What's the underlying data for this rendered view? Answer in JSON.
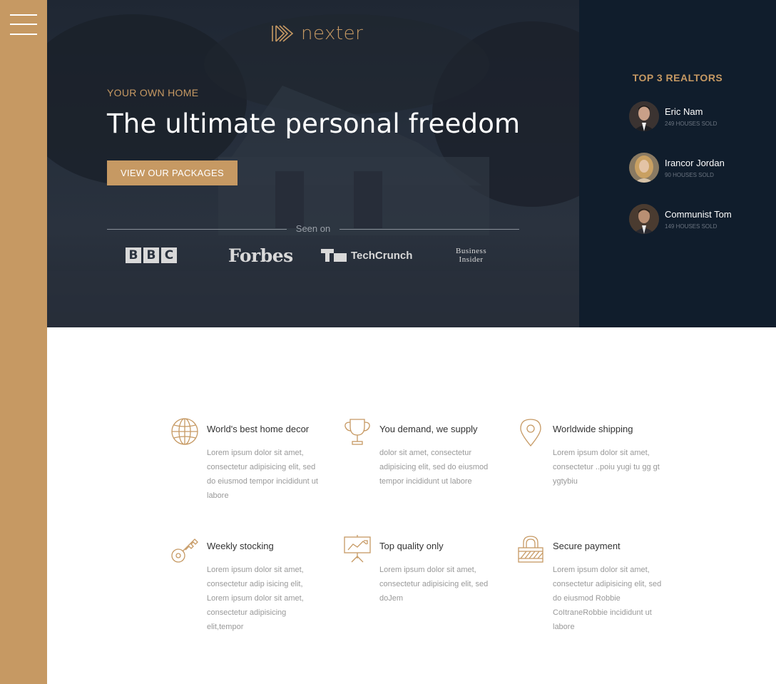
{
  "brand": {
    "logo_text": "nexter",
    "accent": "#c69963",
    "dark": "#101d2c"
  },
  "nav": {
    "menu_icon": "hamburger-icon"
  },
  "hero": {
    "subtitle": "YOUR OWN HOME",
    "title": "The ultimate personal freedom",
    "button": "VIEW OUR PACKAGES",
    "seen_on": "Seen on",
    "press": {
      "bbc": [
        "B",
        "B",
        "C"
      ],
      "forbes": "Forbes",
      "techcrunch": "TechCrunch",
      "business_insider_line1": "Business",
      "business_insider_line2": "Insider"
    }
  },
  "realtors": {
    "title": "TOP 3 REALTORS",
    "items": [
      {
        "name": "Eric Nam",
        "sold": "249 HOUSES SOLD"
      },
      {
        "name": "Irancor Jordan",
        "sold": "90 HOUSES SOLD"
      },
      {
        "name": "Communist Tom",
        "sold": "149 HOUSES SOLD"
      }
    ]
  },
  "features": [
    {
      "icon": "globe-icon",
      "title": "World's best home decor",
      "text": "Lorem ipsum dolor sit amet, consectetur adipisicing elit, sed do eiusmod tempor incididunt ut labore"
    },
    {
      "icon": "trophy-icon",
      "title": "You demand, we supply",
      "text": "dolor sit amet, consectetur adipisicing elit, sed do eiusmod tempor incididunt ut labore"
    },
    {
      "icon": "map-pin-icon",
      "title": "Worldwide shipping",
      "text": "Lorem ipsum dolor sit amet, consectetur ..poiu yugi tu gg gt ygtybiu"
    },
    {
      "icon": "key-icon",
      "title": "Weekly stocking",
      "text": "Lorem ipsum dolor sit amet, consectetur adip isicing elit, Lorem ipsum dolor sit amet, consectetur adipisicing elit,tempor"
    },
    {
      "icon": "presentation-icon",
      "title": "Top quality only",
      "text": "Lorem ipsum dolor sit amet, consectetur adipisicing elit, sed doJem"
    },
    {
      "icon": "padlock-icon",
      "title": "Secure payment",
      "text": "Lorem ipsum dolor sit amet, consectetur adipisicing elit, sed do eiusmod Robbie CoItraneRobbie incididunt ut labore"
    }
  ]
}
